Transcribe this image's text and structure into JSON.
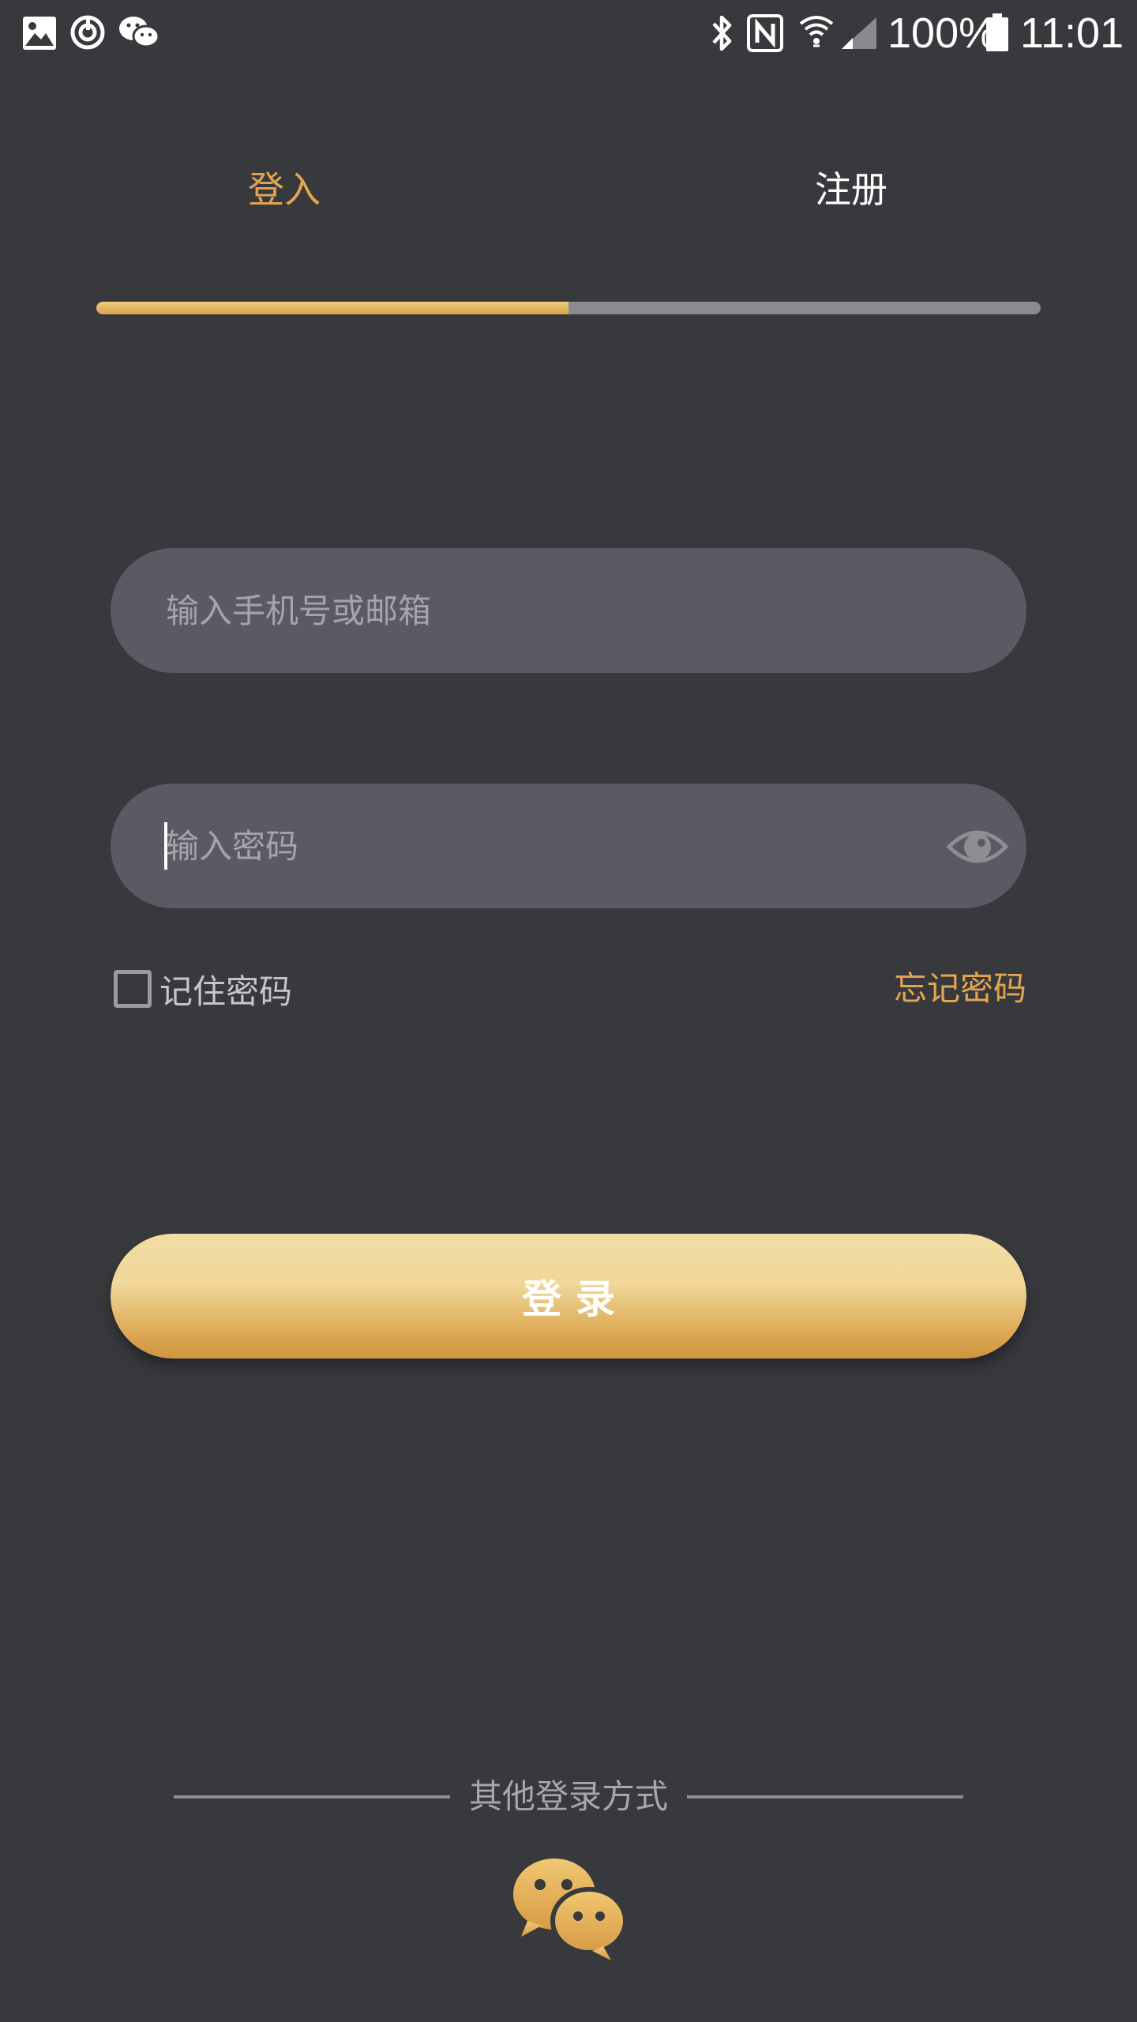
{
  "status_bar": {
    "battery": "100%",
    "time": "11:01"
  },
  "tabs": {
    "login": "登入",
    "register": "注册",
    "active_fraction": 0.5
  },
  "form": {
    "phone_placeholder": "输入手机号或邮箱",
    "password_placeholder": "输入密码",
    "remember_label": "记住密码",
    "remember_checked": false,
    "forgot_label": "忘记密码"
  },
  "login_button": {
    "label": "登录"
  },
  "other_login": {
    "label": "其他登录方式",
    "wechat_icon": "wechat-icon"
  },
  "colors": {
    "background": "#38393d",
    "accent": "#e3a551",
    "field": "#595a63"
  }
}
